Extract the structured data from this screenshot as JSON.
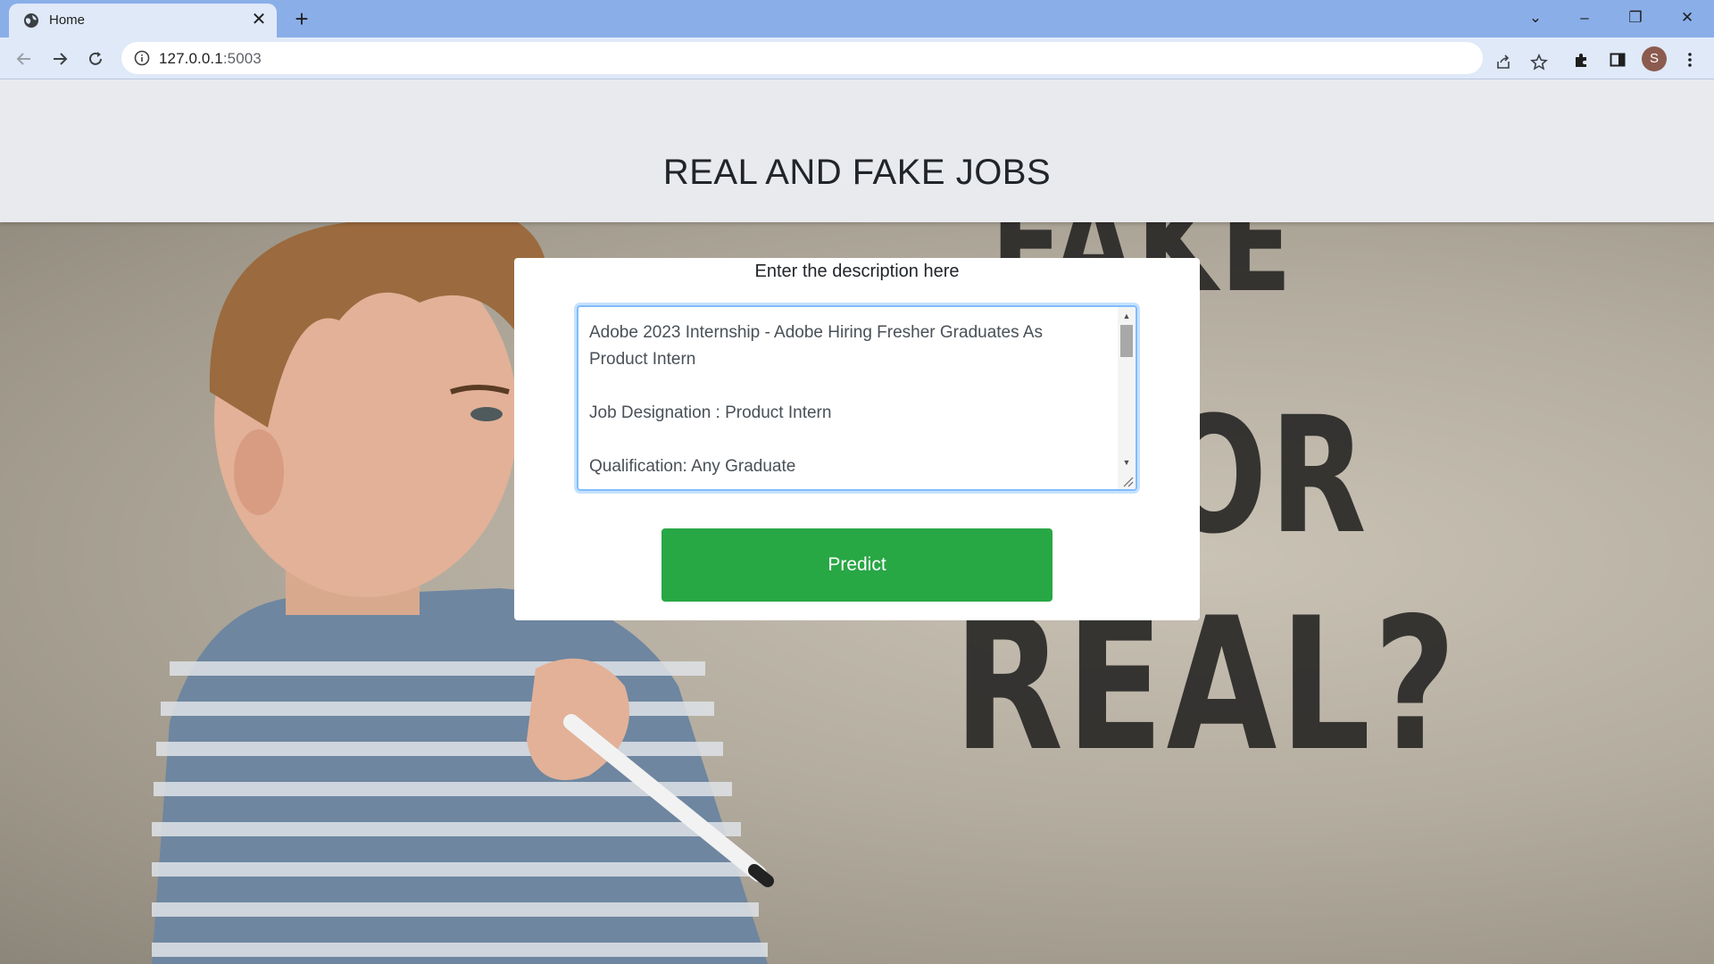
{
  "browser": {
    "tab_title": "Home",
    "tab_close_glyph": "✕",
    "new_tab_glyph": "+",
    "url_host": "127.0.0.1",
    "url_port": ":5003",
    "profile_initial": "S",
    "window_controls": {
      "dropdown": "⌄",
      "minimize": "–",
      "restore": "❐",
      "close": "✕"
    }
  },
  "header": {
    "title": "REAL AND FAKE JOBS"
  },
  "hero": {
    "words": [
      "FAKE",
      "OR",
      "REAL?"
    ]
  },
  "form": {
    "label": "Enter the description here",
    "description_value": "Adobe 2023 Internship - Adobe Hiring Fresher Graduates As Product Intern\n\nJob Designation : Product Intern\n\nQualification: Any Graduate",
    "predict_label": "Predict"
  },
  "colors": {
    "accent_green": "#28a745",
    "chrome_blue": "#8aaee8",
    "focus_blue": "#80bdff"
  },
  "icons": [
    "globe-icon",
    "back-arrow-icon",
    "forward-arrow-icon",
    "reload-icon",
    "info-icon",
    "share-icon",
    "star-icon",
    "puzzle-extension-icon",
    "sidepanel-icon",
    "kebab-menu-icon"
  ]
}
